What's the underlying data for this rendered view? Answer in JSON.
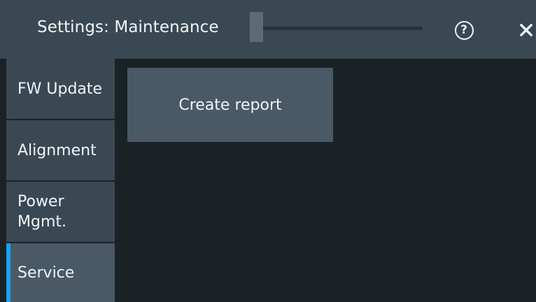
{
  "window": {
    "title": "Settings: Maintenance"
  },
  "titlebar": {
    "help_icon": "help-circle-icon",
    "help_glyph": "?",
    "close_icon": "close-icon"
  },
  "sidebar": {
    "items": [
      {
        "label": "FW Update",
        "active": false
      },
      {
        "label": "Alignment",
        "active": false
      },
      {
        "label": "Power\nMgmt.",
        "active": false
      },
      {
        "label": "Service",
        "active": true
      }
    ]
  },
  "main": {
    "create_report_label": "Create report"
  },
  "colors": {
    "titlebar_bg": "#3a4853",
    "content_bg": "#1b2226",
    "tab_bg": "#3a4853",
    "tab_active_bg": "#495966",
    "accent": "#17a2f0",
    "button_bg": "#495966",
    "text": "#f2f5f7"
  }
}
